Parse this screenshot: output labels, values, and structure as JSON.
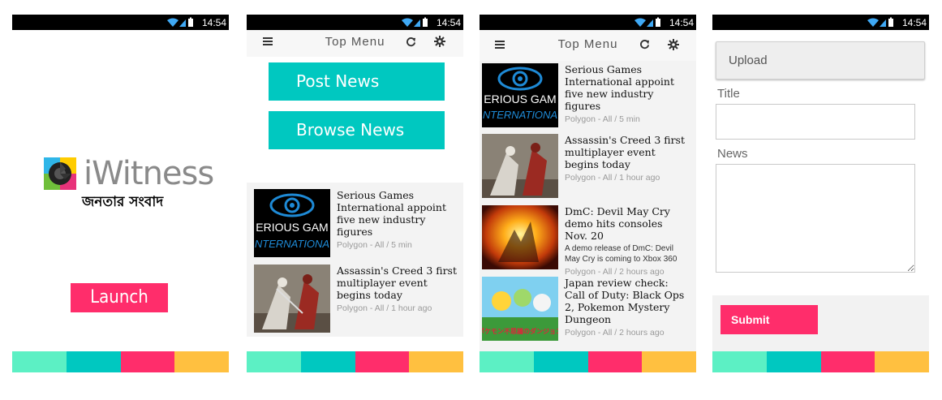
{
  "status": {
    "time": "14:54"
  },
  "colors": {
    "accent_pink": "#ff2d6b",
    "accent_teal": "#00c8c0",
    "bar": [
      "#5cf0c4",
      "#00c8c0",
      "#ff2d6b",
      "#ffc040"
    ]
  },
  "splash": {
    "brand": "iWitness",
    "tagline": "জনতার সংবাদ",
    "launch_label": "Launch"
  },
  "topbar": {
    "title": "Top Menu",
    "icons": [
      "menu-icon",
      "refresh-icon",
      "settings-icon"
    ]
  },
  "home": {
    "post_label": "Post News",
    "browse_label": "Browse News"
  },
  "articles": [
    {
      "title": "Serious Games International appoint five new industry figures",
      "meta": "Polygon - All / 5 min",
      "desc": ""
    },
    {
      "title": "Assassin's Creed 3 first multiplayer event begins today",
      "meta": "Polygon - All / 1 hour ago",
      "desc": ""
    },
    {
      "title": "DmC: Devil May Cry demo hits consoles Nov. 20",
      "meta": "Polygon - All / 2 hours ago",
      "desc": "A demo release of DmC: Devil May Cry is coming to Xbox 360"
    },
    {
      "title": "Japan review check: Call of Duty: Black Ops 2, Pokemon Mystery Dungeon",
      "meta": "Polygon - All / 2 hours ago",
      "desc": ""
    }
  ],
  "thumbs": {
    "sgi_line1": "ERIOUS GAM",
    "sgi_line2": "NTERNATIONA",
    "pokemon_text": "ポケモン不思議のダンジョン"
  },
  "post_form": {
    "upload_label": "Upload",
    "title_label": "Title",
    "title_value": "",
    "news_label": "News",
    "news_value": "",
    "submit_label": "Submit"
  }
}
